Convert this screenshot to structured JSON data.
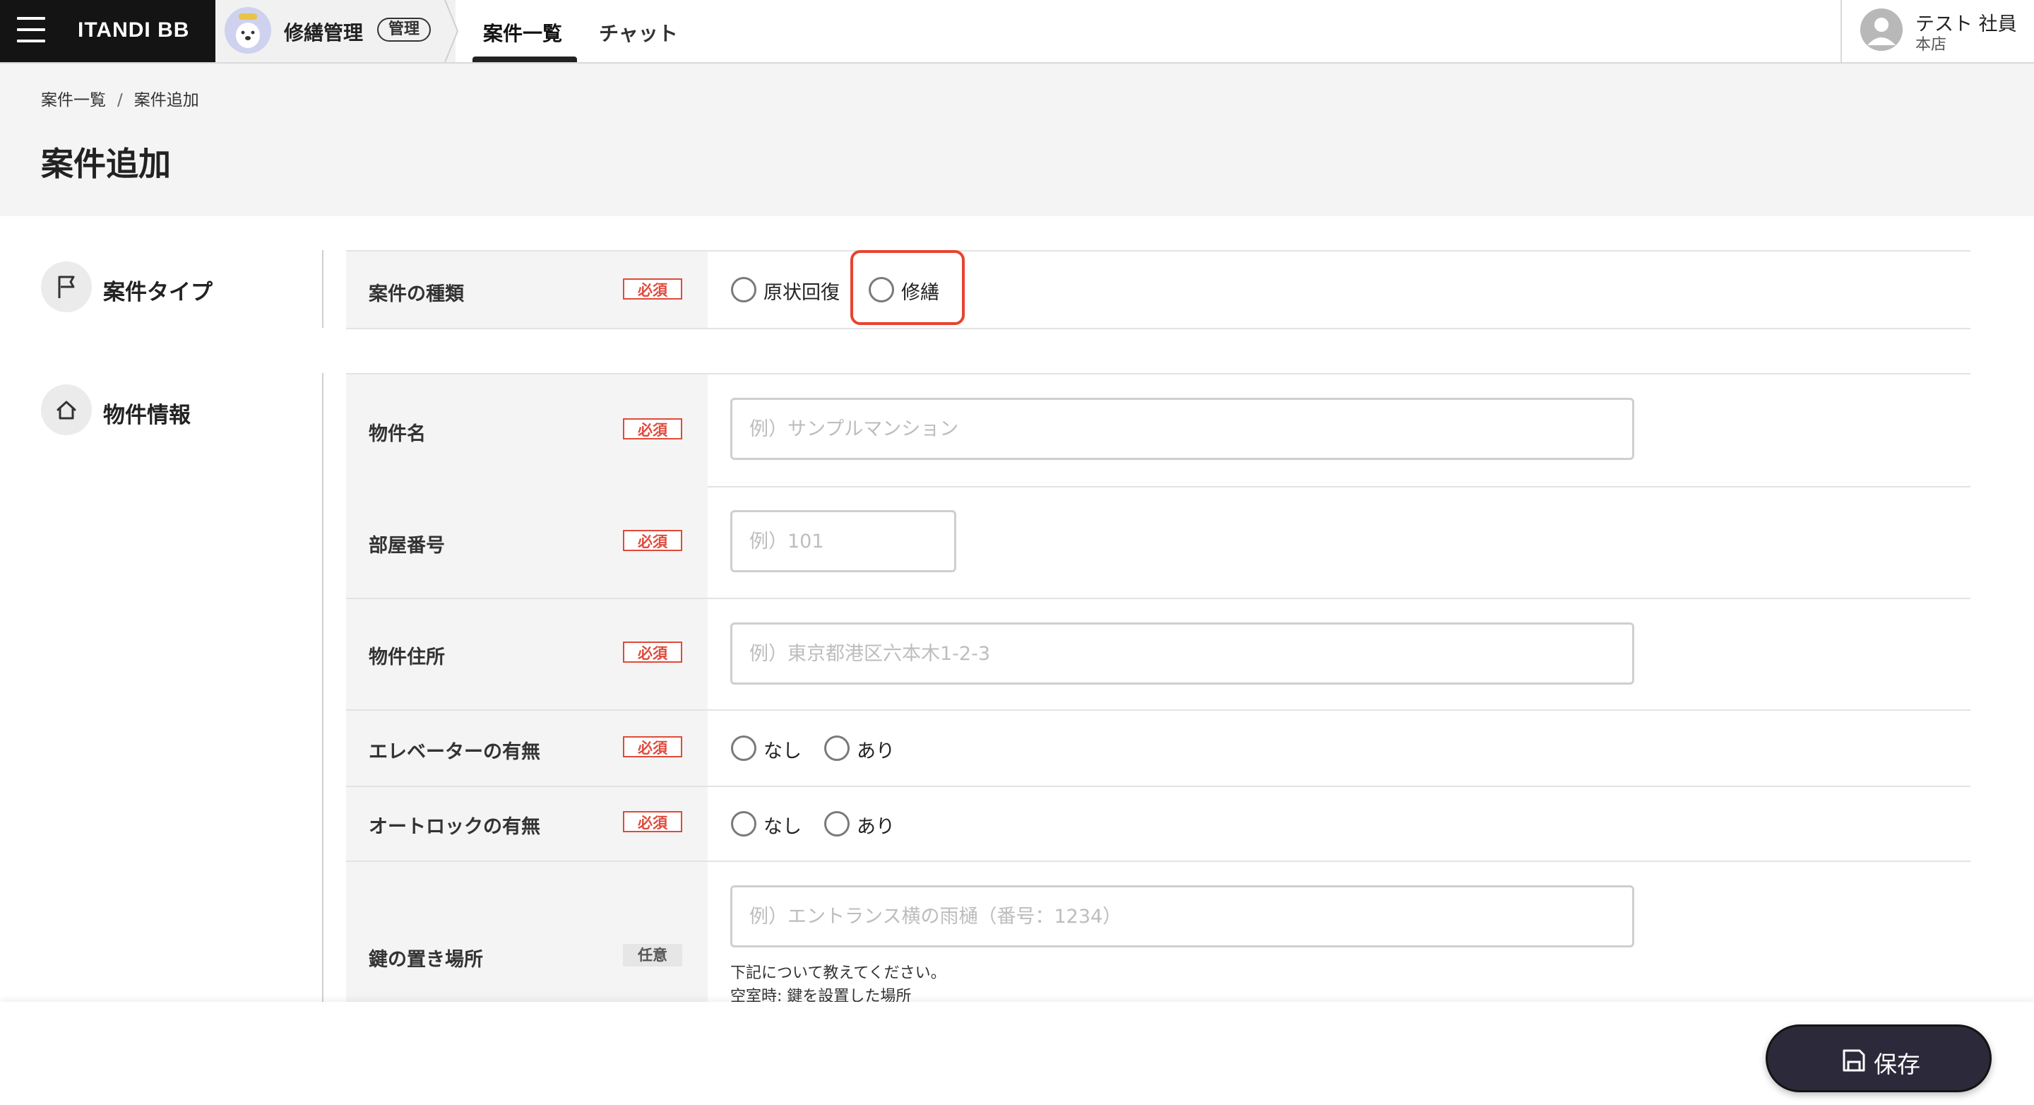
{
  "header": {
    "brand": "ITANDI BB",
    "app_name": "修繕管理",
    "app_badge": "管理",
    "tabs": [
      {
        "label": "案件一覧",
        "active": true
      },
      {
        "label": "チャット",
        "active": false
      }
    ],
    "user": {
      "name": "テスト 社員",
      "branch": "本店"
    }
  },
  "breadcrumb": {
    "items": [
      "案件一覧",
      "案件追加"
    ],
    "separator": "/"
  },
  "page_title": "案件追加",
  "sections": {
    "type": {
      "title": "案件タイプ",
      "field_label": "案件の種類",
      "badge": "必須",
      "options": [
        "原状回復",
        "修繕"
      ]
    },
    "property": {
      "title": "物件情報",
      "fields": {
        "name": {
          "label": "物件名",
          "badge": "必須",
          "placeholder": "例）サンプルマンション"
        },
        "room": {
          "label": "部屋番号",
          "badge": "必須",
          "placeholder": "例）101"
        },
        "address": {
          "label": "物件住所",
          "badge": "必須",
          "placeholder": "例）東京都港区六本木1-2-3"
        },
        "elevator": {
          "label": "エレベーターの有無",
          "badge": "必須",
          "options": [
            "なし",
            "あり"
          ]
        },
        "autolock": {
          "label": "オートロックの有無",
          "badge": "必須",
          "options": [
            "なし",
            "あり"
          ]
        },
        "key": {
          "label": "鍵の置き場所",
          "badge": "任意",
          "placeholder": "例）エントランス横の雨樋（番号：1234）",
          "hint_lines": [
            "下記について教えてください。",
            "空室時: 鍵を設置した場所"
          ]
        }
      }
    }
  },
  "footer": {
    "save_label": "保存"
  },
  "colors": {
    "brand_bg": "#141414",
    "required": "#e04a3a",
    "highlight": "#e8432f",
    "save_button": "#2c2a3a"
  },
  "icons": [
    "menu-icon",
    "app-avatar-icon",
    "user-avatar-icon",
    "flag-icon",
    "home-icon",
    "save-icon"
  ]
}
